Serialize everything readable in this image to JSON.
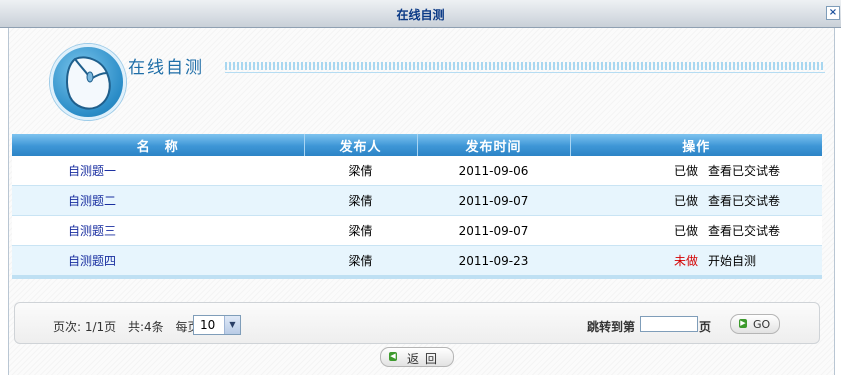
{
  "window": {
    "title": "在线自测",
    "close_glyph": "×"
  },
  "banner": {
    "icon": "mouse-icon",
    "title": "在线自测"
  },
  "table": {
    "headers": [
      "名　称",
      "发布人",
      "发布时间",
      "操作"
    ],
    "rows": [
      {
        "name": "自测题一",
        "publisher": "梁倩",
        "date": "2011-09-06",
        "status": "已做",
        "action": "查看已交试卷"
      },
      {
        "name": "自测题二",
        "publisher": "梁倩",
        "date": "2011-09-07",
        "status": "已做",
        "action": "查看已交试卷"
      },
      {
        "name": "自测题三",
        "publisher": "梁倩",
        "date": "2011-09-07",
        "status": "已做",
        "action": "查看已交试卷"
      },
      {
        "name": "自测题四",
        "publisher": "梁倩",
        "date": "2011-09-23",
        "status": "未做",
        "action": "开始自测"
      }
    ]
  },
  "pager": {
    "page_info": "页次: 1/1页",
    "total": "共:4条",
    "per_page_label": "每页",
    "per_page_value": "10",
    "jump_label": "跳转到第",
    "jump_suffix": "页",
    "go_label": "GO"
  },
  "back_button": {
    "label": "返回"
  },
  "colors": {
    "accent": "#2c84c6",
    "undone": "#d40000",
    "link": "#1a2fa0"
  }
}
